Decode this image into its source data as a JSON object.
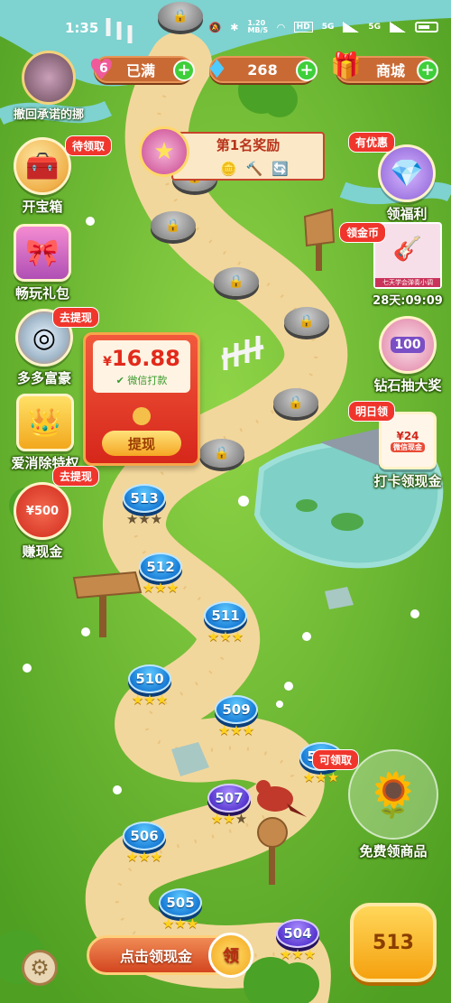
{
  "status": {
    "time": "1:35",
    "net_speed": "1.20\nMB/S",
    "network": "5G"
  },
  "top_bar": {
    "avatar_label": "撤回承诺的挪",
    "hearts_count": "6",
    "hearts_text": "已满",
    "diamonds": "268",
    "shop": "商城"
  },
  "prize_banner": {
    "title": "第1名奖励"
  },
  "left_features": [
    {
      "label": "开宝箱",
      "badge": "待领取",
      "icon": "treasure-chest-icon"
    },
    {
      "label": "畅玩礼包",
      "badge": "",
      "icon": "gift-box-icon"
    },
    {
      "label": "多多富豪",
      "badge": "去提现",
      "icon": "wheel-icon"
    },
    {
      "label": "爱消除特权",
      "badge": "",
      "icon": "crown-card-icon"
    },
    {
      "label": "赚现金",
      "badge": "去提现",
      "icon": "cash-envelope-icon",
      "value": "¥500"
    }
  ],
  "right_features": [
    {
      "label": "领福利",
      "badge": "有优惠",
      "icon": "diamond-bag-icon"
    },
    {
      "label": "28天:09:09",
      "badge": "领金币",
      "icon": "ukulele-ad-icon",
      "ad_caption": "七天学会弹奏小调"
    },
    {
      "label": "钻石抽大奖",
      "badge": "",
      "icon": "diamond-lottery-icon",
      "value": "100"
    },
    {
      "label": "打卡领现金",
      "badge": "明日领",
      "icon": "checkin-cash-icon",
      "value": "¥24",
      "sub": "微信现金"
    }
  ],
  "envelope": {
    "currency": "¥",
    "amount": "16.88",
    "payout": "微信打款",
    "button": "提现"
  },
  "levels": [
    {
      "num": "513",
      "stars": 0,
      "current": true
    },
    {
      "num": "512",
      "stars": 3
    },
    {
      "num": "511",
      "stars": 3
    },
    {
      "num": "510",
      "stars": 3
    },
    {
      "num": "509",
      "stars": 3
    },
    {
      "num": "508",
      "stars": 3
    },
    {
      "num": "507",
      "stars": 2,
      "boss": true
    },
    {
      "num": "506",
      "stars": 3
    },
    {
      "num": "505",
      "stars": 3
    },
    {
      "num": "504",
      "stars": 3,
      "boss": true
    }
  ],
  "freebie": {
    "badge": "可领取",
    "label": "免费领商品"
  },
  "bottom": {
    "collect": "点击领现金",
    "collect_badge": "领",
    "play_level": "513"
  },
  "colors": {
    "grass": "#66bb2e",
    "path": "#f2d79c",
    "water": "#7fd0c6",
    "accent_red": "#f0362c"
  }
}
